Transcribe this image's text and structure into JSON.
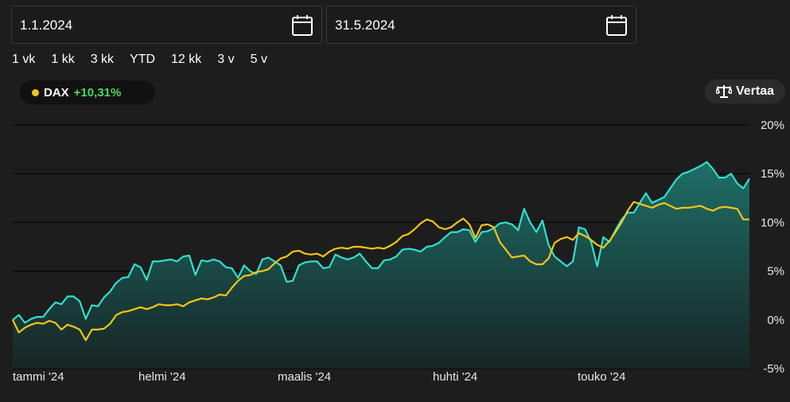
{
  "date_range": {
    "start": "1.1.2024",
    "end": "31.5.2024"
  },
  "range_buttons": [
    "1 vk",
    "1 kk",
    "3 kk",
    "YTD",
    "12 kk",
    "3 v",
    "5 v"
  ],
  "instrument": {
    "name": "DAX",
    "change": "+10,31%",
    "dot_color": "#f5c518",
    "change_color": "#4cd964"
  },
  "compare_label": "Vertaa",
  "colors": {
    "dax_line": "#f5c518",
    "compare_line": "#2fe0cf",
    "area_top": "#1f6e68",
    "area_bottom": "#162524",
    "grid": "#000000"
  },
  "chart_data": {
    "type": "line",
    "x_labels": [
      "tammi '24",
      "helmi '24",
      "maalis '24",
      "huhti '24",
      "touko '24"
    ],
    "y_ticks": [
      "20%",
      "15%",
      "10%",
      "5%",
      "0%",
      "-5%"
    ],
    "ylim": [
      -5,
      20
    ],
    "grid": true,
    "series": [
      {
        "role": "compare",
        "values": [
          0,
          0.5,
          -0.3,
          0.1,
          0.3,
          0.3,
          1.1,
          1.8,
          1.6,
          2.4,
          2.4,
          1.9,
          0.1,
          1.5,
          1.4,
          2.3,
          2.9,
          3.8,
          4.3,
          4.4,
          5.7,
          5.4,
          4.1,
          6.0,
          6.0,
          6.1,
          6.2,
          6.0,
          6.5,
          6.6,
          4.6,
          6.1,
          6.0,
          6.2,
          6.0,
          5.4,
          5.3,
          4.3,
          5.6,
          5.0,
          4.7,
          6.2,
          6.4,
          6.0,
          5.6,
          3.9,
          4.0,
          5.6,
          5.9,
          6.0,
          6.0,
          5.3,
          5.4,
          6.7,
          6.4,
          6.2,
          6.4,
          6.8,
          6.0,
          5.3,
          5.3,
          6.1,
          6.2,
          6.5,
          7.2,
          7.3,
          7.2,
          7.0,
          7.5,
          7.6,
          7.9,
          8.5,
          9.0,
          9.0,
          9.3,
          9.2,
          8.0,
          9.0,
          9.1,
          9.4,
          9.9,
          10.0,
          9.8,
          9.2,
          11.4,
          10.0,
          9.0,
          10.2,
          7.7,
          6.5,
          6.0,
          5.5,
          6.0,
          9.5,
          9.3,
          8.0,
          5.5,
          8.5,
          8.0,
          9.2,
          10.3,
          11.0,
          11.0,
          12.0,
          13.0,
          12.0,
          12.3,
          12.6,
          13.5,
          14.4,
          15.0,
          15.2,
          15.5,
          15.8,
          16.2,
          15.5,
          14.6,
          14.6,
          15.0,
          14.0,
          13.5,
          14.5
        ]
      },
      {
        "role": "DAX",
        "name": "DAX",
        "values": [
          0,
          -1.3,
          -0.8,
          -0.5,
          -0.3,
          -0.4,
          -0.1,
          -0.3,
          -1.0,
          -0.5,
          -0.7,
          -1.0,
          -2.1,
          -1.0,
          -1.0,
          -0.9,
          -0.4,
          0.5,
          0.8,
          0.9,
          1.1,
          1.3,
          1.1,
          1.3,
          1.6,
          1.5,
          1.5,
          1.6,
          1.4,
          1.8,
          2.0,
          2.2,
          2.1,
          2.3,
          2.6,
          2.5,
          3.3,
          4.0,
          4.5,
          4.6,
          4.9,
          5.0,
          5.2,
          5.8,
          6.3,
          6.5,
          7.0,
          7.1,
          6.8,
          6.7,
          6.8,
          6.5,
          7.0,
          7.3,
          7.4,
          7.3,
          7.5,
          7.5,
          7.4,
          7.3,
          7.4,
          7.3,
          7.6,
          8.0,
          8.6,
          8.8,
          9.3,
          9.9,
          10.3,
          10.1,
          9.5,
          9.3,
          9.5,
          10.0,
          10.4,
          9.8,
          8.4,
          9.7,
          9.8,
          9.5,
          8.0,
          7.2,
          6.4,
          6.5,
          6.6,
          6.0,
          5.7,
          5.7,
          6.3,
          7.9,
          8.3,
          8.5,
          8.2,
          8.9,
          8.6,
          8.2,
          7.7,
          7.4,
          8.1,
          9.0,
          10.0,
          11.2,
          12.1,
          11.9,
          11.7,
          11.5,
          11.8,
          12.0,
          11.7,
          11.4,
          11.5,
          11.5,
          11.6,
          11.7,
          11.4,
          11.2,
          11.5,
          11.6,
          11.5,
          11.4,
          10.3,
          10.3
        ]
      }
    ]
  }
}
